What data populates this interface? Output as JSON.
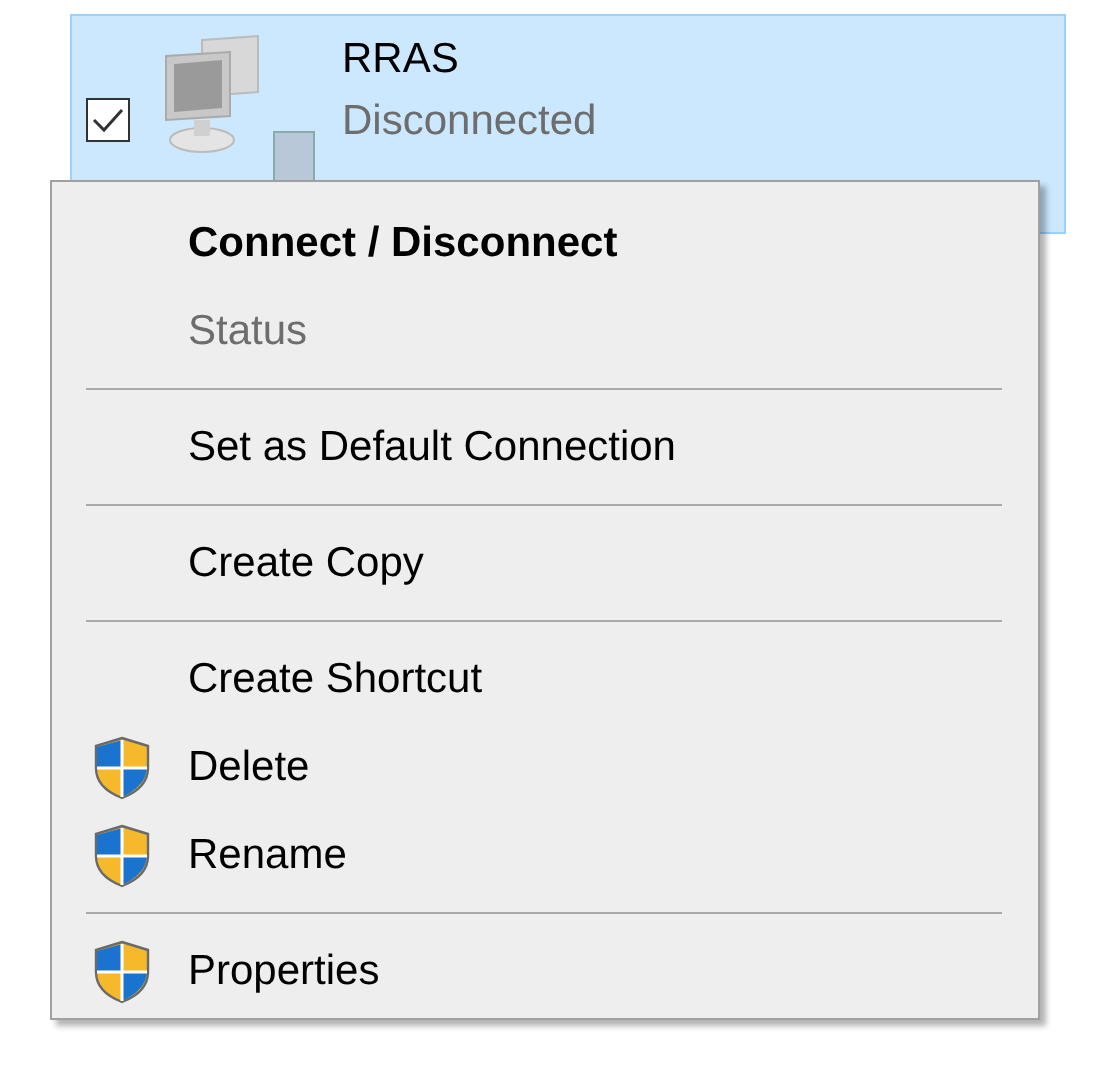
{
  "connection": {
    "name": "RRAS",
    "status": "Disconnected",
    "checked": true,
    "selected": true
  },
  "context_menu": {
    "items": [
      {
        "kind": "item",
        "label": "Connect / Disconnect",
        "default": true,
        "disabled": false,
        "shield": false
      },
      {
        "kind": "item",
        "label": "Status",
        "default": false,
        "disabled": true,
        "shield": false
      },
      {
        "kind": "separator"
      },
      {
        "kind": "item",
        "label": "Set as Default Connection",
        "default": false,
        "disabled": false,
        "shield": false
      },
      {
        "kind": "separator"
      },
      {
        "kind": "item",
        "label": "Create Copy",
        "default": false,
        "disabled": false,
        "shield": false
      },
      {
        "kind": "separator"
      },
      {
        "kind": "item",
        "label": "Create Shortcut",
        "default": false,
        "disabled": false,
        "shield": false
      },
      {
        "kind": "item",
        "label": "Delete",
        "default": false,
        "disabled": false,
        "shield": true
      },
      {
        "kind": "item",
        "label": "Rename",
        "default": false,
        "disabled": false,
        "shield": true
      },
      {
        "kind": "separator"
      },
      {
        "kind": "item",
        "label": "Properties",
        "default": false,
        "disabled": false,
        "shield": true
      }
    ]
  }
}
